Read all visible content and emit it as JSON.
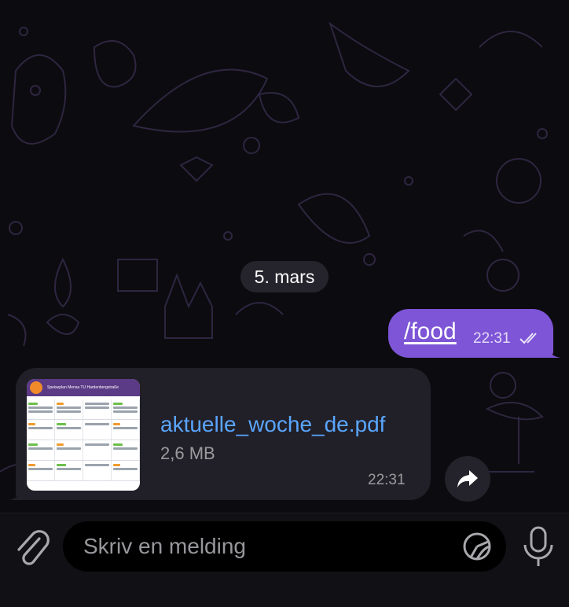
{
  "chat": {
    "date_separator": "5. mars",
    "outgoing": {
      "text": "/food",
      "time": "22:31",
      "status_icon": "double-check-icon"
    },
    "incoming": {
      "file_name": "aktuelle_woche_de.pdf",
      "file_size": "2,6 MB",
      "time": "22:31",
      "thumbnail_title": "Speiseplan Mensa TU Hardenbergstraße"
    }
  },
  "composer": {
    "placeholder": "Skriv en melding",
    "attach_icon": "paperclip-icon",
    "sticker_icon": "sticker-icon",
    "mic_icon": "microphone-icon"
  },
  "colors": {
    "outgoing_bubble": "#7d55d6",
    "incoming_bubble": "#211f27",
    "link": "#5aa6ff",
    "background": "#0c0b0f"
  }
}
